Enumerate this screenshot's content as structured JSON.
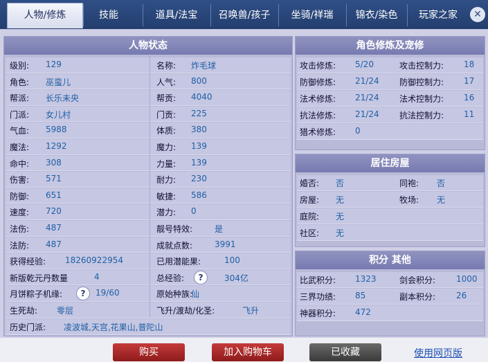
{
  "tabs": [
    "人物/修炼",
    "技能",
    "道具/法宝",
    "召唤兽/孩子",
    "坐骑/祥瑞",
    "锦衣/染色",
    "玩家之家"
  ],
  "close_glyph": "✕",
  "status_panel": {
    "title": "人物状态",
    "rows": [
      [
        {
          "l": "级别:",
          "v": "129"
        },
        {
          "l": "名称:",
          "v": "炸毛球"
        }
      ],
      [
        {
          "l": "角色:",
          "v": "巫蛮儿"
        },
        {
          "l": "人气:",
          "v": "800"
        }
      ],
      [
        {
          "l": "帮派:",
          "v": "长乐未央"
        },
        {
          "l": "帮贡:",
          "v": "4040"
        }
      ],
      [
        {
          "l": "门派:",
          "v": "女儿村"
        },
        {
          "l": "门贡:",
          "v": "225"
        }
      ],
      [
        {
          "l": "气血:",
          "v": "5988"
        },
        {
          "l": "体质:",
          "v": "380"
        }
      ],
      [
        {
          "l": "魔法:",
          "v": "1292"
        },
        {
          "l": "魔力:",
          "v": "139"
        }
      ],
      [
        {
          "l": "命中:",
          "v": "308"
        },
        {
          "l": "力量:",
          "v": "139"
        }
      ],
      [
        {
          "l": "伤害:",
          "v": "571"
        },
        {
          "l": "耐力:",
          "v": "230"
        }
      ],
      [
        {
          "l": "防御:",
          "v": "651"
        },
        {
          "l": "敏捷:",
          "v": "586"
        }
      ],
      [
        {
          "l": "速度:",
          "v": "720"
        },
        {
          "l": "潜力:",
          "v": "0"
        }
      ],
      [
        {
          "l": "法伤:",
          "v": "487"
        },
        {
          "l": "靓号特效:",
          "v": "是"
        }
      ],
      [
        {
          "l": "法防:",
          "v": "487"
        },
        {
          "l": "成就点数:",
          "v": "3991"
        }
      ],
      [
        {
          "l": "获得经验:",
          "v": "18260922954"
        },
        {
          "l": "已用潜能果:",
          "v": "100"
        }
      ],
      [
        {
          "l": "新版乾元丹数量",
          "v": "4"
        },
        {
          "l": "总经验:",
          "v": "304亿"
        }
      ],
      [
        {
          "l": "月饼粽子机缘:",
          "v": "19/60"
        },
        {
          "l": "原始种族:",
          "v": "仙"
        }
      ],
      [
        {
          "l": "生死劫:",
          "v": "零层"
        },
        {
          "l": "飞升/渡劫/化圣:",
          "v": "飞升"
        }
      ]
    ],
    "history": {
      "l": "历史门派:",
      "v": "凌波城,天宫,花果山,普陀山"
    },
    "help_glyph": "?"
  },
  "cultivation_panel": {
    "title": "角色修炼及宠修",
    "rows": [
      [
        {
          "l": "攻击修炼:",
          "v": "5/20"
        },
        {
          "l": "攻击控制力:",
          "v": "18"
        }
      ],
      [
        {
          "l": "防御修炼:",
          "v": "21/24"
        },
        {
          "l": "防御控制力:",
          "v": "17"
        }
      ],
      [
        {
          "l": "法术修炼:",
          "v": "21/24"
        },
        {
          "l": "法术控制力:",
          "v": "16"
        }
      ],
      [
        {
          "l": "抗法修炼:",
          "v": "21/24"
        },
        {
          "l": "抗法控制力:",
          "v": "11"
        }
      ],
      [
        {
          "l": "猎术修炼:",
          "v": "0"
        }
      ]
    ]
  },
  "housing_panel": {
    "title": "居住房屋",
    "rows": [
      [
        {
          "l": "婚否:",
          "v": "否"
        },
        {
          "l": "同袍:",
          "v": "否"
        }
      ],
      [
        {
          "l": "房屋:",
          "v": "无"
        },
        {
          "l": "牧场:",
          "v": "无"
        }
      ],
      [
        {
          "l": "庭院:",
          "v": "无"
        }
      ],
      [
        {
          "l": "社区:",
          "v": "无"
        }
      ]
    ]
  },
  "points_panel": {
    "title": "积分 其他",
    "rows": [
      [
        {
          "l": "比武积分:",
          "v": "1323"
        },
        {
          "l": "剑会积分:",
          "v": "1000"
        }
      ],
      [
        {
          "l": "三界功绩:",
          "v": "85"
        },
        {
          "l": "副本积分:",
          "v": "26"
        }
      ],
      [
        {
          "l": "神器积分:",
          "v": "472"
        }
      ]
    ]
  },
  "actions": {
    "buy": "购买",
    "cart": "加入购物车",
    "fav": "已收藏",
    "web": "使用网页版"
  }
}
